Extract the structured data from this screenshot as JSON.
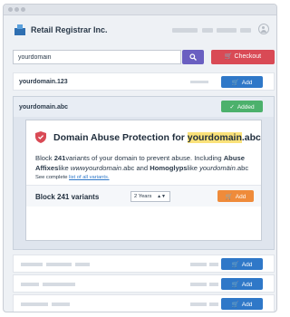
{
  "header": {
    "brand": "Retail Registrar Inc."
  },
  "search": {
    "value": "yourdomain",
    "checkout_label": "Checkout"
  },
  "results": [
    {
      "domain": "yourdomain.123",
      "action": "Add"
    },
    {
      "domain": "yourdomain.abc",
      "action": "Added"
    }
  ],
  "promo": {
    "title_prefix": "Domain Abuse Protection for ",
    "title_domain": "yourdomain",
    "title_suffix": ".abc",
    "line1_a": "Block ",
    "line1_num": "241",
    "line1_b": "variants of your domain to prevent abuse. Including ",
    "line1_c": "Abuse",
    "line2_a": "Affixes",
    "line2_b": "like ",
    "line2_c": "wwwyourdomain",
    "line2_d": ".abc and ",
    "line2_e": "Homoglyps",
    "line2_f": "like ",
    "line2_g": "yourdomäin",
    "line2_h": ".abc",
    "see_prefix": "See complete ",
    "see_link": "list of all variants.",
    "block_label": "Block 241 variants",
    "years": "2 Years",
    "add": "Add"
  },
  "placeholder_rows": {
    "action": "Add",
    "count": 5
  },
  "colors": {
    "primary": "#2f78c8",
    "added": "#4cb16c",
    "checkout": "#d94a55",
    "search": "#6a5fc1",
    "promo_add": "#ef8b3a",
    "highlight": "#fbe27a"
  }
}
